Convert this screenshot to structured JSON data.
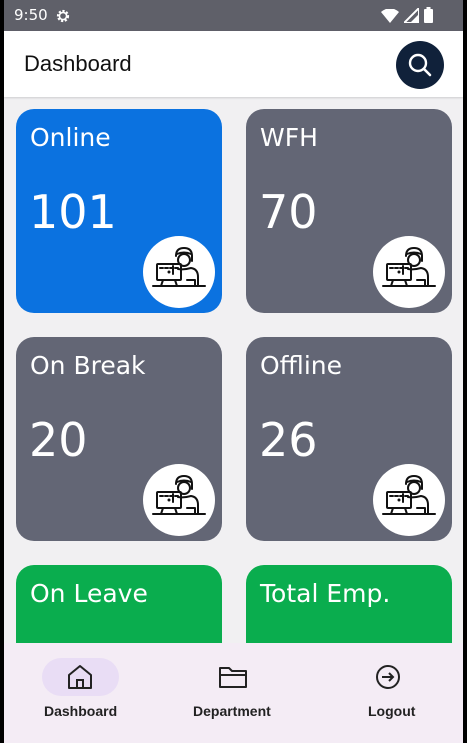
{
  "status_bar": {
    "time": "9:50",
    "icons": [
      "settings-icon",
      "wifi-icon",
      "signal-icon",
      "battery-icon"
    ]
  },
  "app_bar": {
    "title": "Dashboard",
    "search_icon": "search-icon"
  },
  "cards": [
    {
      "label": "Online",
      "value": "101",
      "color": "#0b72e0"
    },
    {
      "label": "WFH",
      "value": "70",
      "color": "#636675"
    },
    {
      "label": "On Break",
      "value": "20",
      "color": "#636675"
    },
    {
      "label": "Offline",
      "value": "26",
      "color": "#636675"
    },
    {
      "label": "On Leave",
      "value": "",
      "color": "#0aad4e"
    },
    {
      "label": "Total Emp.",
      "value": "",
      "color": "#0aad4e"
    }
  ],
  "bottom_nav": {
    "items": [
      {
        "label": "Dashboard",
        "icon": "home-icon",
        "selected": true
      },
      {
        "label": "Department",
        "icon": "folder-icon",
        "selected": false
      },
      {
        "label": "Logout",
        "icon": "logout-icon",
        "selected": false
      }
    ]
  },
  "colors": {
    "status_bar": "#5f6069",
    "search_button": "#10213a",
    "nav_background": "#f4ecf5",
    "nav_pill": "#e9ddf5"
  }
}
